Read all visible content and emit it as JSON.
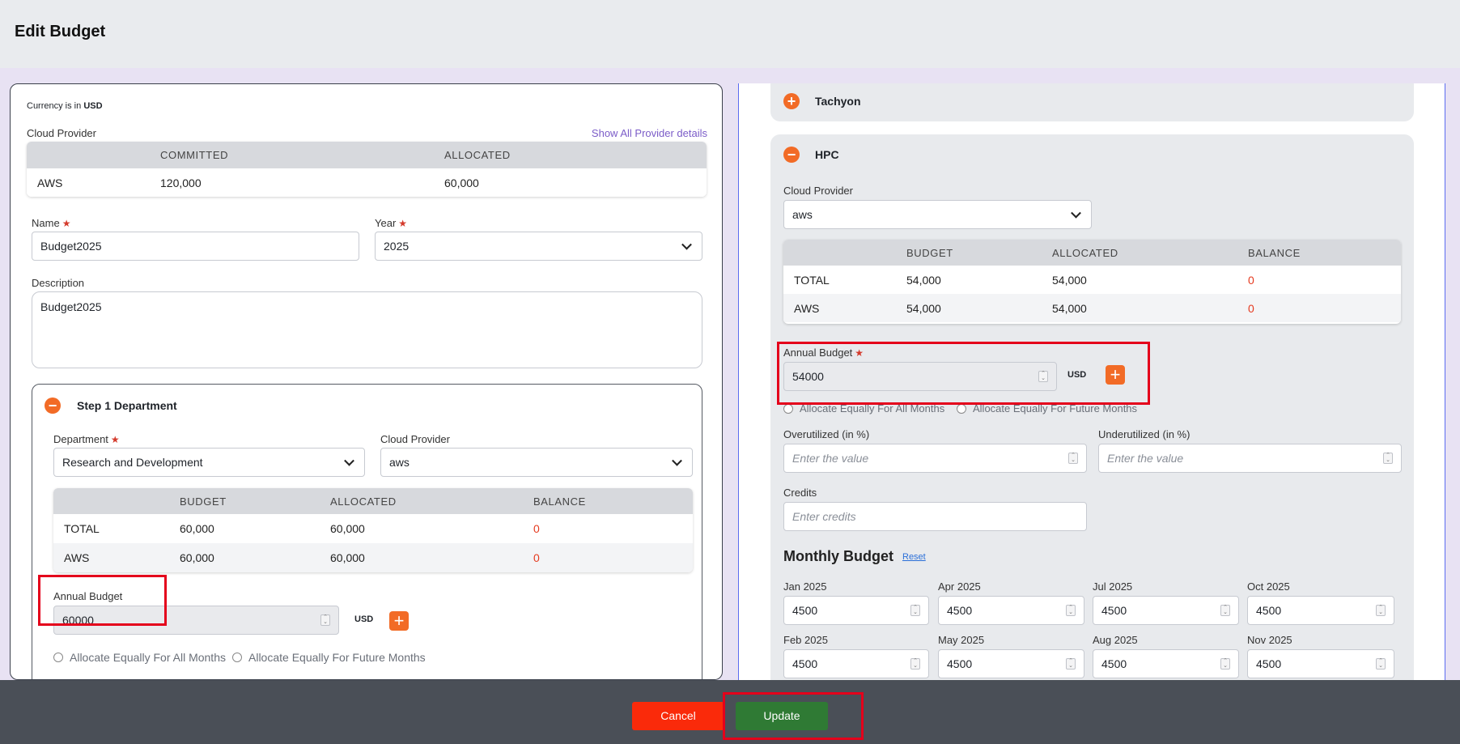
{
  "page": {
    "title": "Edit Budget"
  },
  "left": {
    "currency_prefix": "Currency is in",
    "currency": "USD",
    "cloud_provider_label": "Cloud Provider",
    "show_all_link": "Show All Provider details",
    "provider_table": {
      "headers": [
        "COMMITTED",
        "ALLOCATED"
      ],
      "row": {
        "provider": "AWS",
        "committed": "120,000",
        "allocated": "60,000"
      }
    },
    "name_label": "Name",
    "name_value": "Budget2025",
    "year_label": "Year",
    "year_value": "2025",
    "description_label": "Description",
    "description_value": "Budget2025",
    "step": {
      "title": "Step 1 Department",
      "toggle": "−",
      "department_label": "Department",
      "department_value": "Research and Development",
      "cloud_provider_label": "Cloud Provider",
      "cloud_provider_value": "aws",
      "table": {
        "headers": [
          "BUDGET",
          "ALLOCATED",
          "BALANCE"
        ],
        "rows": [
          {
            "name": "TOTAL",
            "budget": "60,000",
            "allocated": "60,000",
            "balance": "0"
          },
          {
            "name": "AWS",
            "budget": "60,000",
            "allocated": "60,000",
            "balance": "0"
          }
        ]
      },
      "annual_budget_label": "Annual Budget",
      "annual_budget_value": "60000",
      "currency": "USD",
      "add": "+",
      "radio_all": "Allocate Equally For All Months",
      "radio_future": "Allocate Equally For Future Months"
    }
  },
  "right": {
    "tachyon": {
      "title": "Tachyon",
      "toggle": "+"
    },
    "hpc": {
      "title": "HPC",
      "toggle": "−",
      "cloud_provider_label": "Cloud Provider",
      "cloud_provider_value": "aws",
      "table": {
        "headers": [
          "BUDGET",
          "ALLOCATED",
          "BALANCE"
        ],
        "rows": [
          {
            "name": "TOTAL",
            "budget": "54,000",
            "allocated": "54,000",
            "balance": "0"
          },
          {
            "name": "AWS",
            "budget": "54,000",
            "allocated": "54,000",
            "balance": "0"
          }
        ]
      },
      "annual_budget_label": "Annual Budget",
      "annual_budget_value": "54000",
      "currency": "USD",
      "add": "+",
      "radio_all": "Allocate Equally For All Months",
      "radio_future": "Allocate Equally For Future Months",
      "overutilized_label": "Overutilized (in %)",
      "underutilized_label": "Underutilized (in %)",
      "value_placeholder": "Enter the value",
      "credits_label": "Credits",
      "credits_placeholder": "Enter credits",
      "monthly_title": "Monthly Budget",
      "reset": "Reset",
      "months": [
        {
          "label": "Jan 2025",
          "value": "4500"
        },
        {
          "label": "Apr 2025",
          "value": "4500"
        },
        {
          "label": "Jul 2025",
          "value": "4500"
        },
        {
          "label": "Oct 2025",
          "value": "4500"
        },
        {
          "label": "Feb 2025",
          "value": "4500"
        },
        {
          "label": "May 2025",
          "value": "4500"
        },
        {
          "label": "Aug 2025",
          "value": "4500"
        },
        {
          "label": "Nov 2025",
          "value": "4500"
        }
      ]
    }
  },
  "footer": {
    "cancel": "Cancel",
    "update": "Update"
  },
  "colors": {
    "accent_orange": "#f26b26",
    "cancel_red": "#fa2a0a",
    "update_green": "#2f7a34",
    "highlight_red": "#e4001b",
    "link_purple": "#7b5cc8"
  }
}
